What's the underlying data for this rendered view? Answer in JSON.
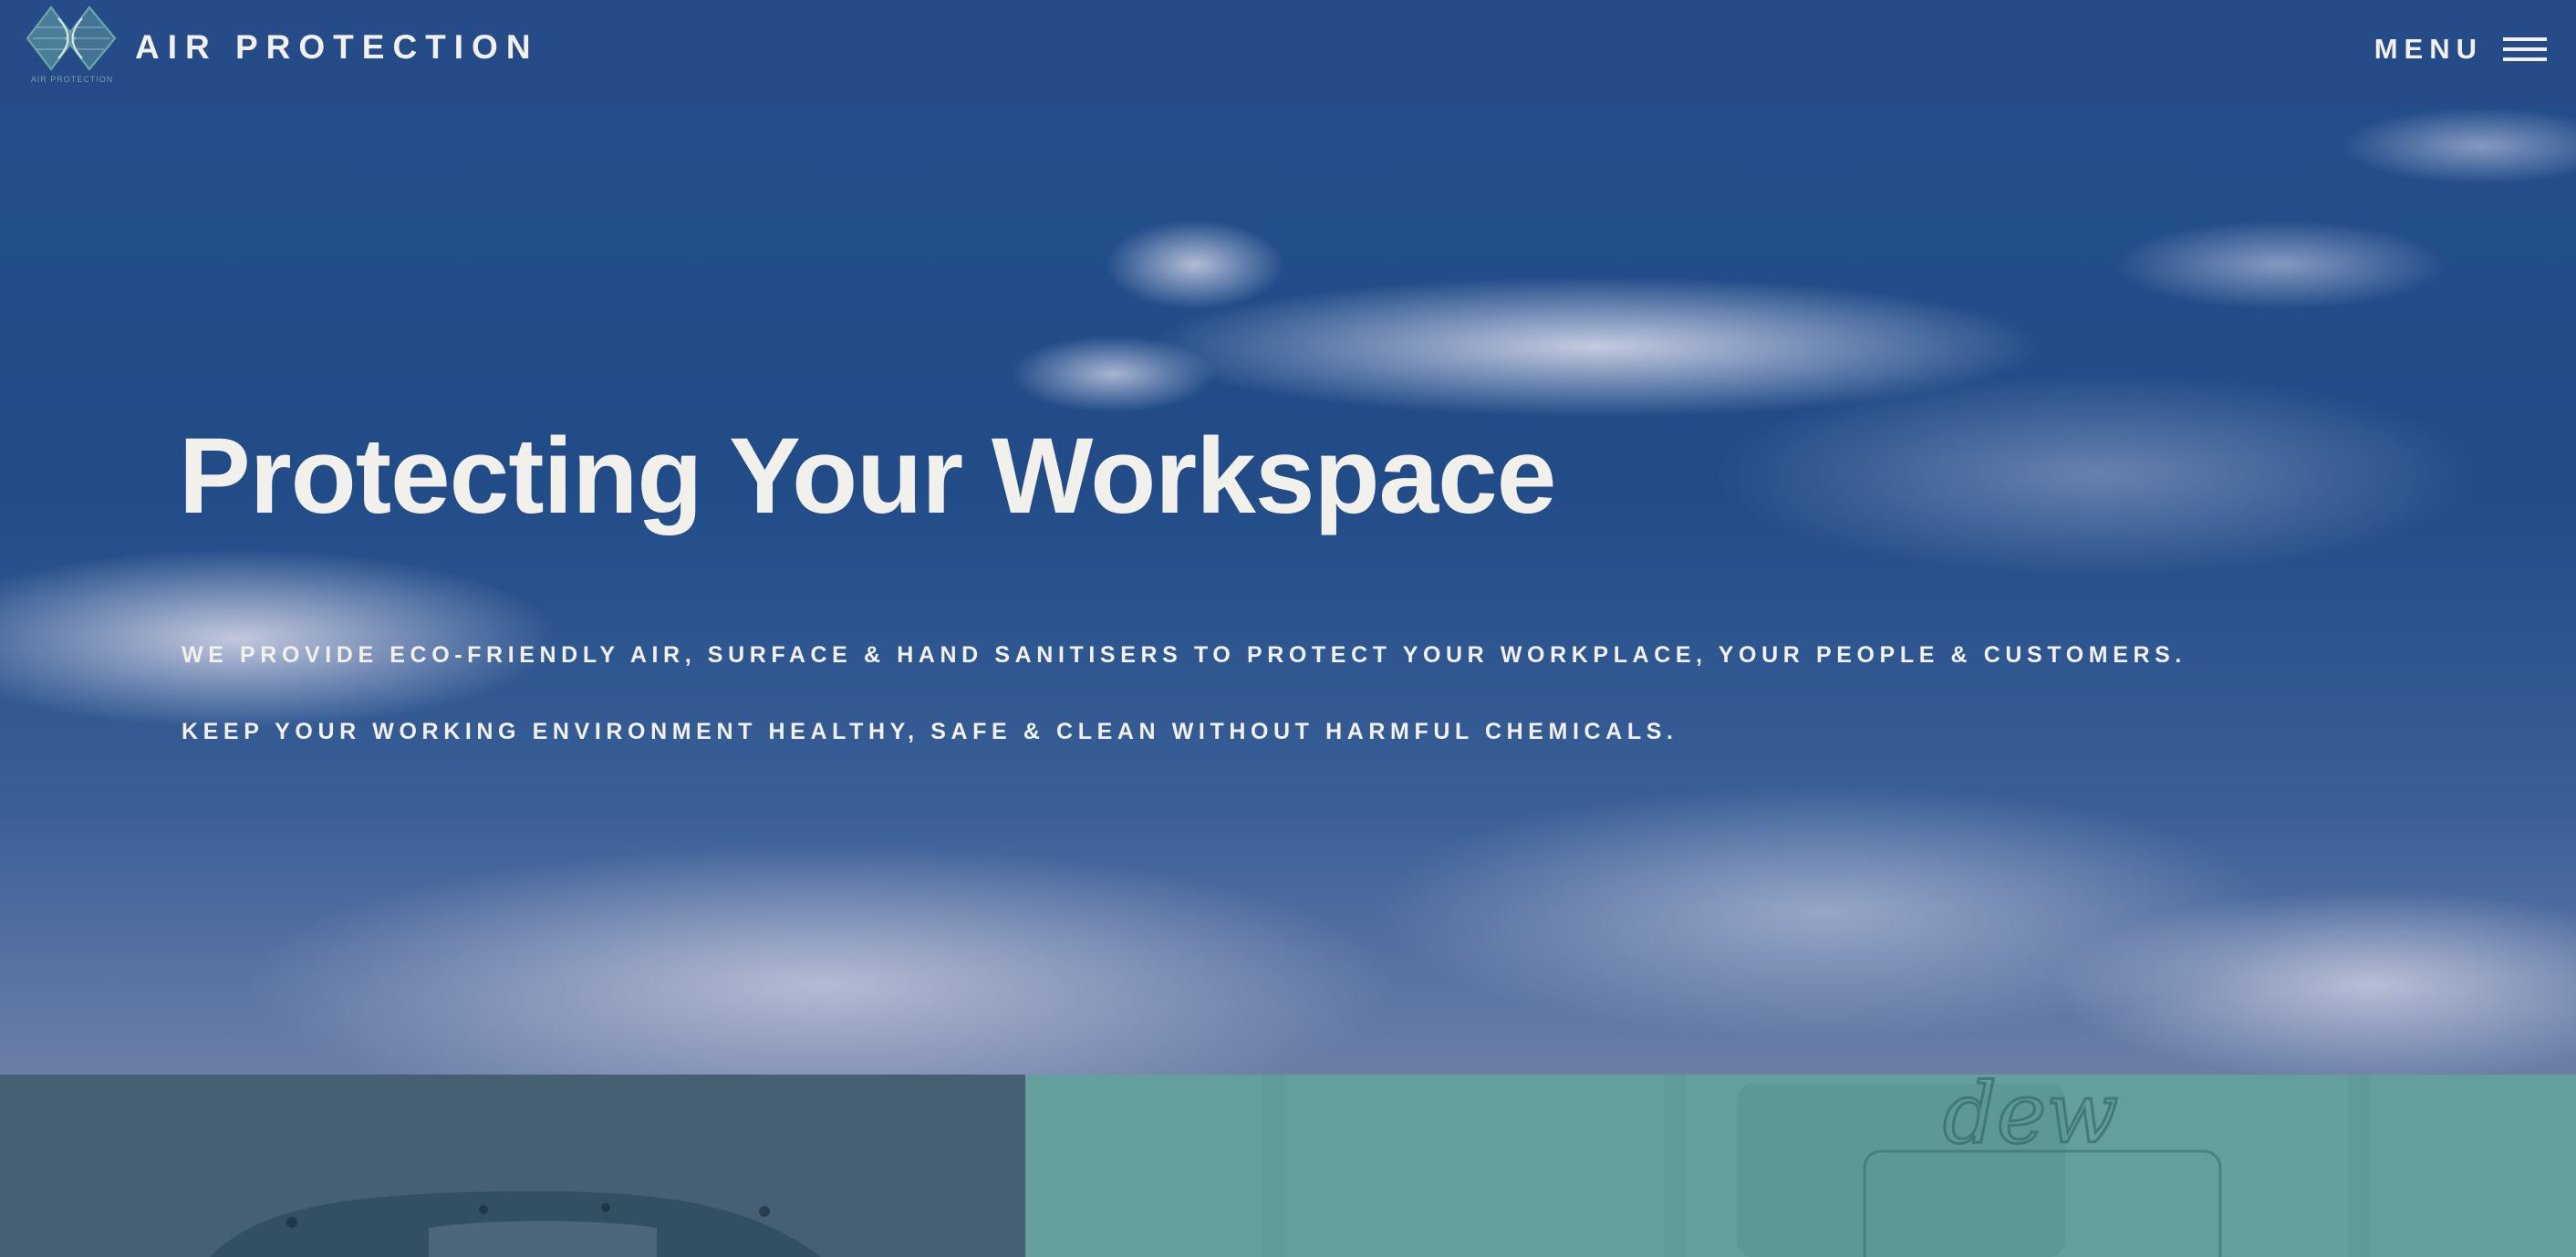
{
  "header": {
    "brand": "AIR PROTECTION",
    "logo_caption": "AIR PROTECTION",
    "menu_label": "MENU",
    "menu_icon": "hamburger-icon"
  },
  "hero": {
    "headline": "Protecting Your Workspace",
    "lines": [
      "WE PROVIDE ECO-FRIENDLY AIR, SURFACE & HAND SANITISERS TO PROTECT YOUR WORKPLACE, YOUR PEOPLE & CUSTOMERS.",
      "KEEP YOUR WORKING ENVIRONMENT HEALTHY, SAFE & CLEAN WITHOUT HARMFUL CHEMICALS."
    ]
  },
  "cards": {
    "right_logo_text": "dew"
  },
  "colors": {
    "navbar": "#2b4a83",
    "text": "#f2f0ea",
    "logo": "#6aa7a5",
    "card_left": "#446072",
    "card_right": "#649e9d"
  }
}
